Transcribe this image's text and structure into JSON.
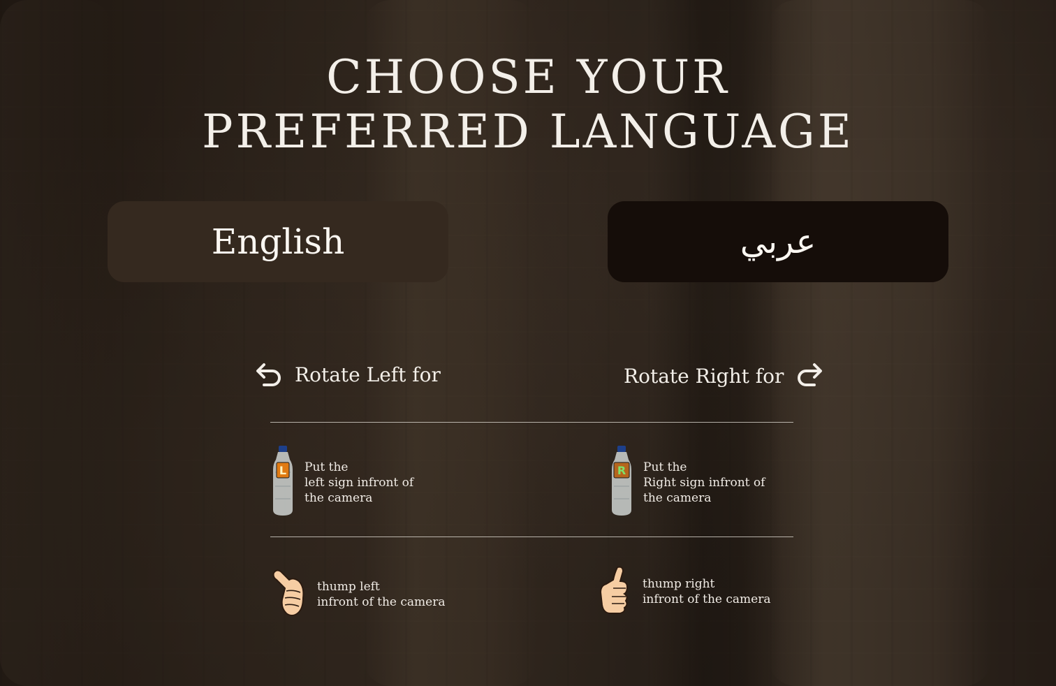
{
  "title": {
    "line1": "CHOOSE YOUR",
    "line2": "PREFERRED LANGUAGE"
  },
  "buttons": {
    "english_label": "English",
    "arabic_label": "عربي"
  },
  "rotate": {
    "left_label": "Rotate Left for",
    "right_label": "Rotate Right for",
    "left_icon": "rotate-left-arrow-icon",
    "right_icon": "rotate-right-arrow-icon"
  },
  "instructions": {
    "left_sign": {
      "line1": "Put the",
      "line2": "left sign infront of",
      "line3": "the camera",
      "badge": "L",
      "icon": "water-bottle-icon"
    },
    "right_sign": {
      "line1": "Put the",
      "line2": "Right sign infront of",
      "line3": "the camera",
      "badge": "R",
      "icon": "water-bottle-icon"
    },
    "thumb_left": {
      "line1": "thump left",
      "line2": "infront of the camera",
      "icon": "thumb-left-icon"
    },
    "thumb_right": {
      "line1": "thump right",
      "line2": "infront of the camera",
      "icon": "thumb-up-icon"
    }
  },
  "colors": {
    "english_button_bg": "#35291f",
    "arabic_button_bg": "#150d09",
    "text": "#f3efe9",
    "badge_left_bg": "#e07a12",
    "badge_right_bg": "#4fa23a"
  }
}
